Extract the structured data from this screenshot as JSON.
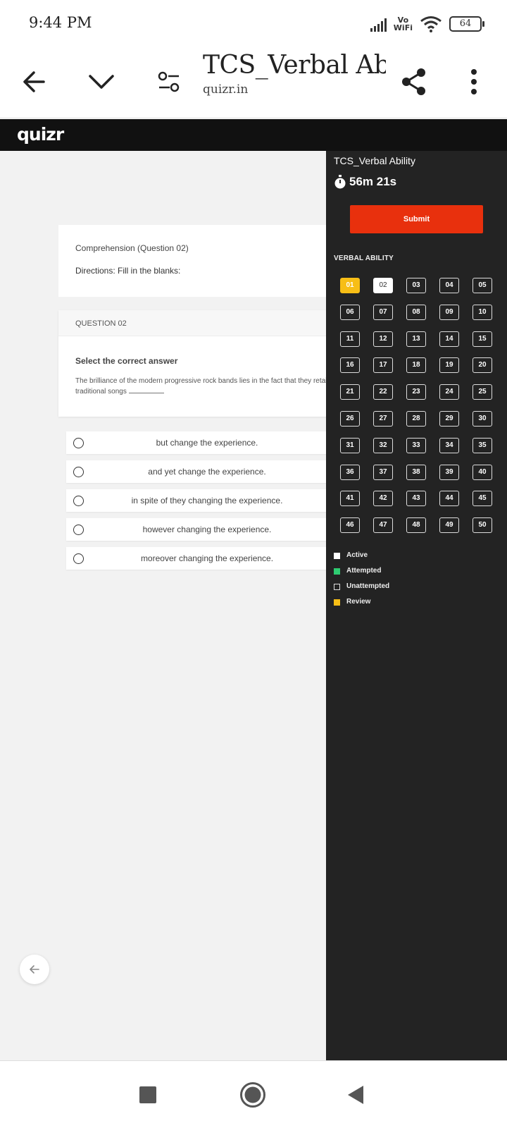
{
  "status_bar": {
    "time": "9:44 PM",
    "vowifi_top": "Vo",
    "vowifi_bottom": "WiFi",
    "battery": "64"
  },
  "browser": {
    "tab_title": "TCS_Verbal Ab...",
    "domain": "quizr.in"
  },
  "app": {
    "logo": "quizr"
  },
  "comprehension": {
    "title": "Comprehension (Question 02)",
    "directions": "Directions: Fill in the blanks:"
  },
  "question": {
    "label": "QUESTION 02",
    "prompt": "Select the correct answer",
    "text_before": "The brilliance of the modern progressive rock bands lies in the fact that they retain traditional songs"
  },
  "options": [
    "but change the experience.",
    "and yet change the experience.",
    "in spite of they changing the experience.",
    "however changing the experience.",
    "moreover changing the experience."
  ],
  "sidebar": {
    "title": "TCS_Verbal Ability",
    "timer": "56m 21s",
    "submit_label": "Submit",
    "section": "VERBAL ABILITY",
    "questions": [
      "01",
      "02",
      "03",
      "04",
      "05",
      "06",
      "07",
      "08",
      "09",
      "10",
      "11",
      "12",
      "13",
      "14",
      "15",
      "16",
      "17",
      "18",
      "19",
      "20",
      "21",
      "22",
      "23",
      "24",
      "25",
      "26",
      "27",
      "28",
      "29",
      "30",
      "31",
      "32",
      "33",
      "34",
      "35",
      "36",
      "37",
      "38",
      "39",
      "40",
      "41",
      "42",
      "43",
      "44",
      "45",
      "46",
      "47",
      "48",
      "49",
      "50"
    ],
    "review_question": "01",
    "active_question": "02",
    "legend": [
      {
        "label": "Active",
        "color": "#ffffff",
        "outline": false
      },
      {
        "label": "Attempted",
        "color": "#2ecc71",
        "outline": false
      },
      {
        "label": "Unattempted",
        "color": "transparent",
        "outline": true
      },
      {
        "label": "Review",
        "color": "#f7be16",
        "outline": false
      }
    ]
  },
  "colors": {
    "submit": "#e8300d",
    "review": "#f7be16",
    "sidebar_bg": "#232323",
    "header_bg": "#111111"
  }
}
